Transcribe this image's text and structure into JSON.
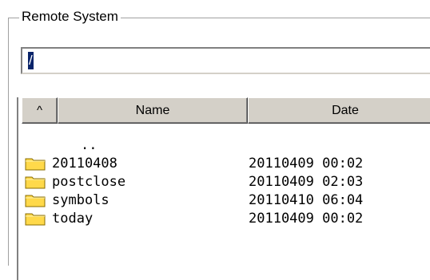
{
  "group": {
    "title": "Remote System"
  },
  "path_input": {
    "value": "/"
  },
  "columns": {
    "sort_indicator": "^",
    "name": "Name",
    "date": "Date"
  },
  "files": [
    {
      "name": "..",
      "date": ""
    },
    {
      "name": "20110408",
      "date": "20110409 00:02",
      "icon": "folder-icon"
    },
    {
      "name": "postclose",
      "date": "20110409 02:03",
      "icon": "folder-icon"
    },
    {
      "name": "symbols",
      "date": "20110410 06:04",
      "icon": "folder-icon"
    },
    {
      "name": "today",
      "date": "20110409 00:02",
      "icon": "folder-icon"
    }
  ],
  "colors": {
    "selection": "#0a246a",
    "header_bg": "#d4d0c8",
    "folder": "#ffd94a"
  }
}
